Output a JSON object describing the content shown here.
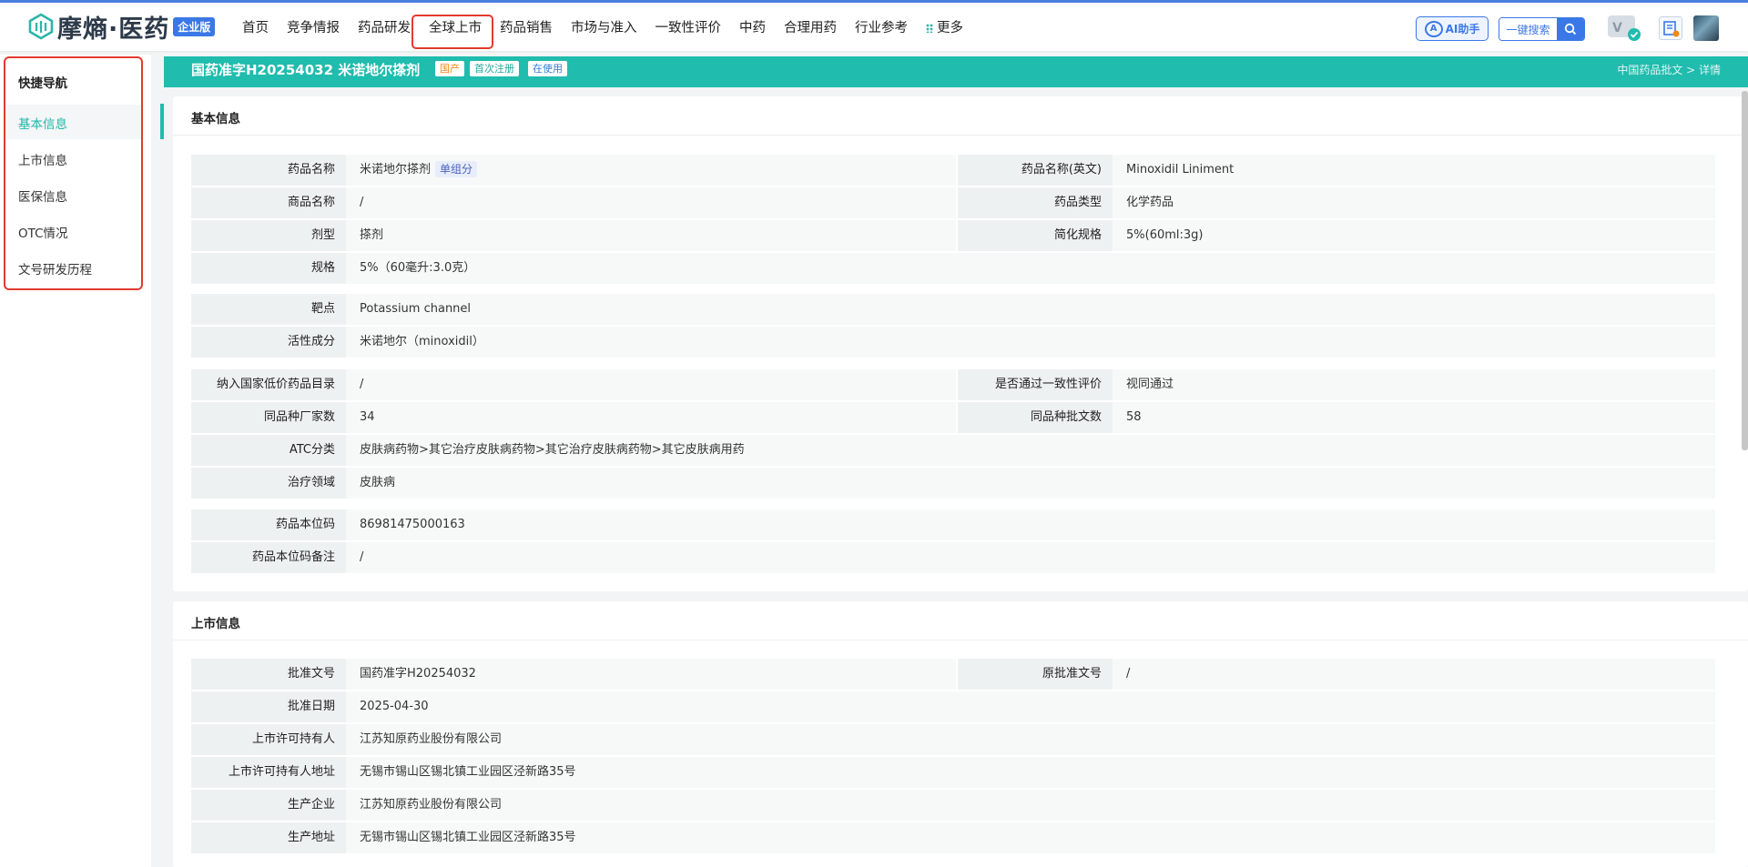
{
  "brand": {
    "name": "摩熵·医药",
    "edition": "企业版"
  },
  "nav": {
    "items": [
      "首页",
      "竞争情报",
      "药品研发",
      "全球上市",
      "药品销售",
      "市场与准入",
      "一致性评价",
      "中药",
      "合理用药",
      "行业参考"
    ],
    "more": "更多"
  },
  "toolbar": {
    "ai_label": "AI助手",
    "search_label": "一键搜索"
  },
  "sidebar": {
    "title": "快捷导航",
    "items": [
      "基本信息",
      "上市信息",
      "医保信息",
      "OTC情况",
      "文号研发历程"
    ]
  },
  "header": {
    "title": "国药准字H20254032  米诺地尔搽剂",
    "tags": [
      "国产",
      "首次注册",
      "在使用"
    ],
    "breadcrumb": "中国药品批文 > 详情"
  },
  "basic": {
    "title": "基本信息",
    "drug_name_label": "药品名称",
    "drug_name": "米诺地尔搽剂",
    "drug_name_tag": "单组分",
    "drug_name_en_label": "药品名称(英文)",
    "drug_name_en": "Minoxidil Liniment",
    "trade_name_label": "商品名称",
    "trade_name": "/",
    "drug_type_label": "药品类型",
    "drug_type": "化学药品",
    "dosage_form_label": "剂型",
    "dosage_form": "搽剂",
    "simple_spec_label": "简化规格",
    "simple_spec": "5%(60ml:3g)",
    "spec_label": "规格",
    "spec": "5%（60毫升:3.0克）",
    "target_label": "靶点",
    "target": "Potassium channel",
    "ingredient_label": "活性成分",
    "ingredient": "米诺地尔（minoxidil）",
    "low_price_label": "纳入国家低价药品目录",
    "low_price": "/",
    "consistency_label": "是否通过一致性评价",
    "consistency": "视同通过",
    "mfr_count_label": "同品种厂家数",
    "mfr_count": "34",
    "approval_count_label": "同品种批文数",
    "approval_count": "58",
    "atc_label": "ATC分类",
    "atc": "皮肤病药物>其它治疗皮肤病药物>其它治疗皮肤病药物>其它皮肤病用药",
    "therapy_label": "治疗领域",
    "therapy": "皮肤病",
    "code_label": "药品本位码",
    "code": "86981475000163",
    "code_note_label": "药品本位码备注",
    "code_note": "/"
  },
  "market": {
    "title": "上市信息",
    "approval_no_label": "批准文号",
    "approval_no": "国药准字H20254032",
    "orig_no_label": "原批准文号",
    "orig_no": "/",
    "approval_date_label": "批准日期",
    "approval_date": "2025-04-30",
    "holder_label": "上市许可持有人",
    "holder": "江苏知原药业股份有限公司",
    "holder_addr_label": "上市许可持有人地址",
    "holder_addr": "无锡市锡山区锡北镇工业园区泾新路35号",
    "producer_label": "生产企业",
    "producer": "江苏知原药业股份有限公司",
    "producer_addr_label": "生产地址",
    "producer_addr": "无锡市锡山区锡北镇工业园区泾新路35号"
  },
  "colors": {
    "accent": "#20bcae",
    "brand_blue": "#3b78e7",
    "highlight_red": "#e23b2e"
  }
}
